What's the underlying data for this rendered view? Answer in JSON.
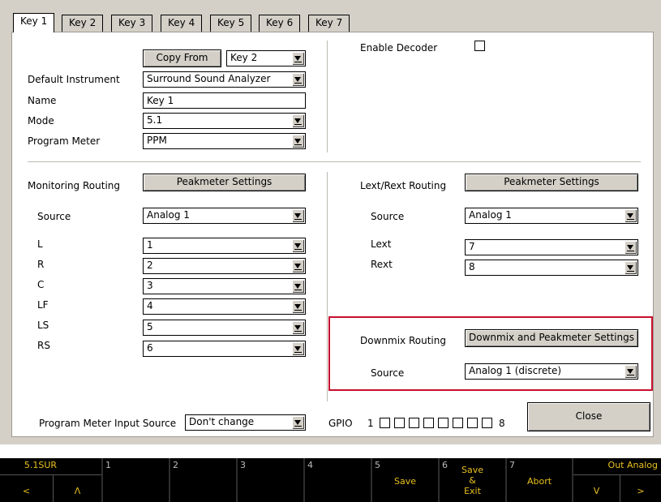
{
  "tabs": [
    "Key 1",
    "Key 2",
    "Key 3",
    "Key 4",
    "Key 5",
    "Key 6",
    "Key 7"
  ],
  "general": {
    "copy_from_label": "Copy From",
    "copy_from_value": "Key 2",
    "default_instrument_label": "Default Instrument",
    "default_instrument_value": "Surround Sound Analyzer",
    "name_label": "Name",
    "name_value": "Key 1",
    "mode_label": "Mode",
    "mode_value": "5.1",
    "program_meter_label": "Program Meter",
    "program_meter_value": "PPM",
    "enable_decoder_label": "Enable Decoder"
  },
  "monitoring": {
    "title": "Monitoring Routing",
    "settings_button": "Peakmeter Settings",
    "source_label": "Source",
    "source_value": "Analog 1",
    "channels": [
      {
        "label": "L",
        "value": "1"
      },
      {
        "label": "R",
        "value": "2"
      },
      {
        "label": "C",
        "value": "3"
      },
      {
        "label": "LF",
        "value": "4"
      },
      {
        "label": "LS",
        "value": "5"
      },
      {
        "label": "RS",
        "value": "6"
      }
    ]
  },
  "lext": {
    "title": "Lext/Rext Routing",
    "settings_button": "Peakmeter Settings",
    "source_label": "Source",
    "source_value": "Analog 1",
    "lext_label": "Lext",
    "lext_value": "7",
    "rext_label": "Rext",
    "rext_value": "8"
  },
  "downmix": {
    "title": "Downmix Routing",
    "settings_button": "Downmix and Peakmeter Settings",
    "source_label": "Source",
    "source_value": "Analog 1 (discrete)",
    "highlight_color": "#c8102e"
  },
  "bottom": {
    "program_meter_input_label": "Program Meter Input Source",
    "program_meter_input_value": "Don't change",
    "gpio_label": "GPIO",
    "gpio_start": "1",
    "gpio_end": "8",
    "close_label": "Close"
  },
  "fkeys": {
    "k0_top": "5.1SUR",
    "k0_left": "<",
    "k0_right": "Λ",
    "k1": "1",
    "k2": "2",
    "k3": "3",
    "k4": "4",
    "k5_num": "5",
    "k5_label": "Save",
    "k6_num": "6",
    "k6_l1": "Save",
    "k6_l2": "&",
    "k6_l3": "Exit",
    "k7_num": "7",
    "k7_label": "Abort",
    "k8_top": "Out Analog",
    "k8_left": "V",
    "k8_right": ">",
    "text_color": "#e8c020"
  }
}
